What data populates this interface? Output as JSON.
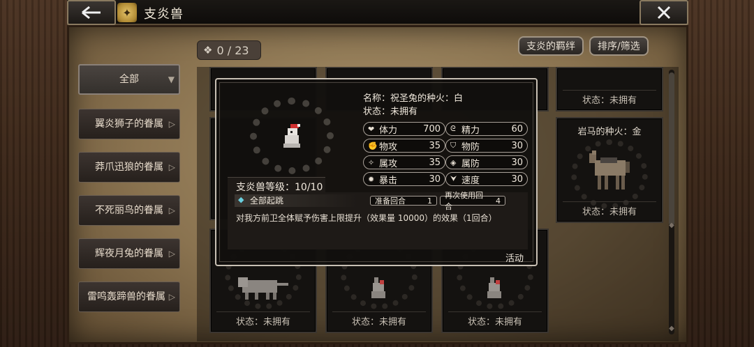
{
  "header": {
    "title": "支炎兽",
    "back_icon": "arrow-left-icon",
    "close_icon": "close-icon",
    "title_icon": "beast-emblem-icon"
  },
  "counter": {
    "icon": "paw-icon",
    "text": "0 / 23"
  },
  "top_buttons": {
    "bond": "支炎的羁绊",
    "sort": "排序/筛选"
  },
  "categories": [
    {
      "label": "全部",
      "active": true
    },
    {
      "label": "翼炎狮子的眷属"
    },
    {
      "label": "莽爪迅狼的眷属"
    },
    {
      "label": "不死丽鸟的眷属"
    },
    {
      "label": "辉夜月兔的眷属"
    },
    {
      "label": "雷鸣轰蹄兽的眷属"
    }
  ],
  "cards": {
    "top_right_status": "状态：未拥有",
    "horse": {
      "name": "岩马的种火：金",
      "status": "状态：未拥有"
    },
    "bottom": [
      {
        "status": "状态：未拥有"
      },
      {
        "status": "状态：未拥有"
      },
      {
        "status": "状态：未拥有"
      }
    ]
  },
  "popup": {
    "name_line": "名称：祝圣兔的种火：白",
    "status_line": "状态：未拥有",
    "stats": [
      {
        "icon": "heart-icon",
        "label": "体力",
        "value": "700"
      },
      {
        "icon": "spirit-icon",
        "label": "精力",
        "value": "60"
      },
      {
        "icon": "fist-icon",
        "label": "物攻",
        "value": "35"
      },
      {
        "icon": "shield-icon",
        "label": "物防",
        "value": "30"
      },
      {
        "icon": "magic-attack-icon",
        "label": "属攻",
        "value": "35"
      },
      {
        "icon": "magic-defense-icon",
        "label": "属防",
        "value": "30"
      },
      {
        "icon": "crit-icon",
        "label": "暴击",
        "value": "30"
      },
      {
        "icon": "boot-icon",
        "label": "速度",
        "value": "30"
      }
    ],
    "level": "支炎兽等级：10/10",
    "skill": {
      "name": "全部起跳",
      "prep_label": "准备回合",
      "prep_value": "1",
      "reuse_label": "再次使用回合",
      "reuse_value": "4",
      "description": "对我方前卫全体赋予伤害上限提升（效果量 10000）的效果（1回合）"
    },
    "activity": "活动"
  }
}
